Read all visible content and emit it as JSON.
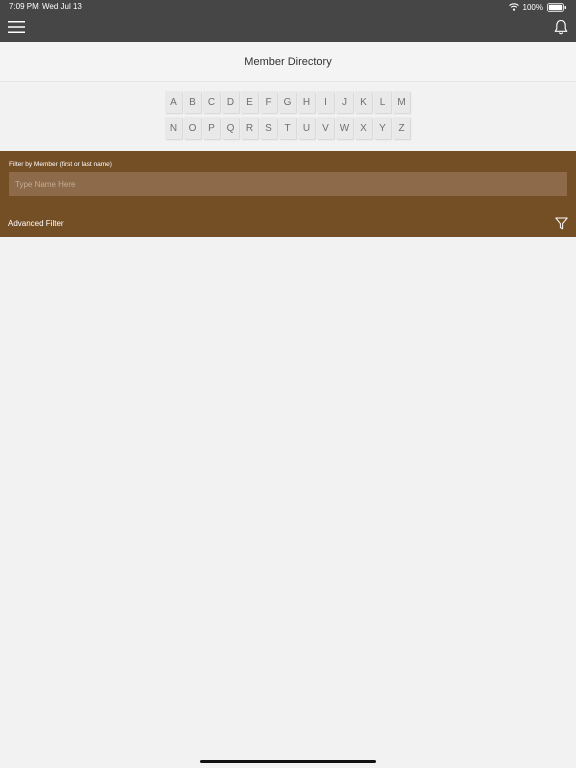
{
  "status_bar": {
    "time": "7:09 PM",
    "date": "Wed Jul 13",
    "battery": "100%"
  },
  "header": {
    "menu_icon": "hamburger-menu-icon",
    "notification_icon": "bell-icon"
  },
  "page": {
    "title": "Member Directory"
  },
  "letters": {
    "row1": [
      "A",
      "B",
      "C",
      "D",
      "E",
      "F",
      "G",
      "H",
      "I",
      "J",
      "K",
      "L",
      "M"
    ],
    "row2": [
      "N",
      "O",
      "P",
      "Q",
      "R",
      "S",
      "T",
      "U",
      "V",
      "W",
      "X",
      "Y",
      "Z"
    ]
  },
  "filter": {
    "label": "Filter by Member (first or last name)",
    "placeholder": "Type Name Here",
    "value": "",
    "advanced_label": "Advanced Filter",
    "icon": "funnel-icon"
  },
  "colors": {
    "header_bg": "#464646",
    "filter_bg": "#744e25",
    "page_bg": "#f2f2f2"
  }
}
